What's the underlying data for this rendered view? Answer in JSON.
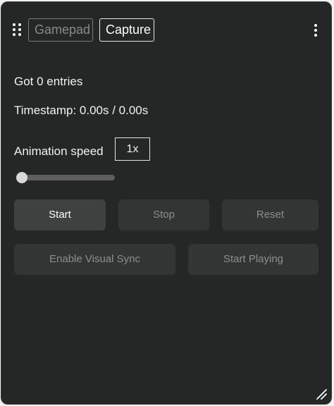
{
  "header": {
    "tabs": [
      {
        "label": "Gamepad"
      },
      {
        "label": "Capture"
      }
    ],
    "drag_icon": "drag-grip-icon",
    "menu_icon": "kebab-menu-icon"
  },
  "status": {
    "entries_text": "Got 0 entries",
    "timestamp_text": "Timestamp: 0.00s / 0.00s"
  },
  "animation": {
    "label": "Animation speed",
    "value": "1x",
    "slider_level": 0
  },
  "buttons": {
    "start": "Start",
    "stop": "Stop",
    "reset": "Reset",
    "enable_visual_sync": "Enable Visual Sync",
    "start_playing": "Start Playing"
  },
  "colors": {
    "panel_bg": "#252626",
    "button_bg": "#333434",
    "active_button_bg": "#3f4040",
    "disabled_text": "#8e8e8e"
  },
  "resize_icon": "resize-grip-icon"
}
